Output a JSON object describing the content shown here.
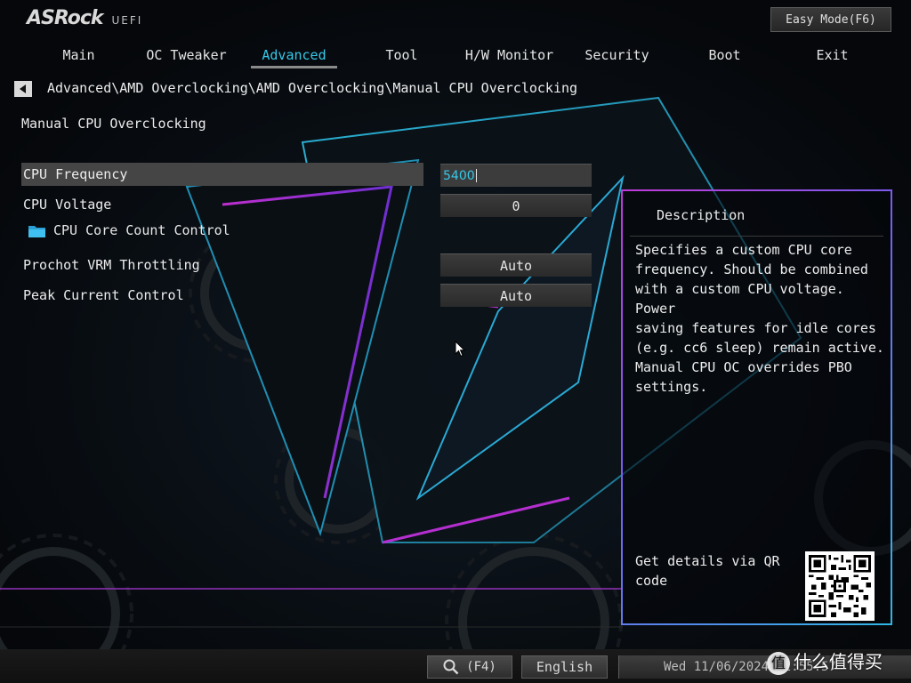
{
  "header": {
    "brand": "ASRock",
    "brand_sub": "UEFI",
    "easy_mode_label": "Easy Mode(F6)"
  },
  "tabs": [
    {
      "label": "Main",
      "active": false
    },
    {
      "label": "OC Tweaker",
      "active": false
    },
    {
      "label": "Advanced",
      "active": true
    },
    {
      "label": "Tool",
      "active": false
    },
    {
      "label": "H/W Monitor",
      "active": false
    },
    {
      "label": "Security",
      "active": false
    },
    {
      "label": "Boot",
      "active": false
    },
    {
      "label": "Exit",
      "active": false
    }
  ],
  "breadcrumb": "Advanced\\AMD Overclocking\\AMD Overclocking\\Manual CPU Overclocking",
  "page_title": "Manual CPU Overclocking",
  "settings": {
    "cpu_frequency": {
      "label": "CPU Frequency",
      "value": "5400"
    },
    "cpu_voltage": {
      "label": "CPU Voltage",
      "value": "0"
    },
    "core_count": {
      "label": "CPU Core Count Control",
      "icon": "folder-icon"
    },
    "prochot": {
      "label": "Prochot VRM Throttling",
      "value": "Auto"
    },
    "peak_current": {
      "label": "Peak Current Control",
      "value": "Auto"
    }
  },
  "description": {
    "title": "Description",
    "body": "Specifies a custom CPU core\nfrequency. Should be combined\nwith a custom CPU voltage. Power\nsaving features for idle cores\n(e.g. cc6 sleep) remain active.\nManual CPU OC overrides PBO\nsettings.",
    "qr_text": "Get details via QR code"
  },
  "bottom_bar": {
    "search_label": "(F4)",
    "language": "English",
    "datetime": "Wed 11/06/2024 22:55:57"
  },
  "watermark": {
    "badge": "值",
    "text": "什么值得买"
  },
  "colors": {
    "accent": "#35c9e8",
    "panel_border_start": "#c03ad8",
    "panel_border_end": "#2fb7e6",
    "background": "#06080b"
  }
}
